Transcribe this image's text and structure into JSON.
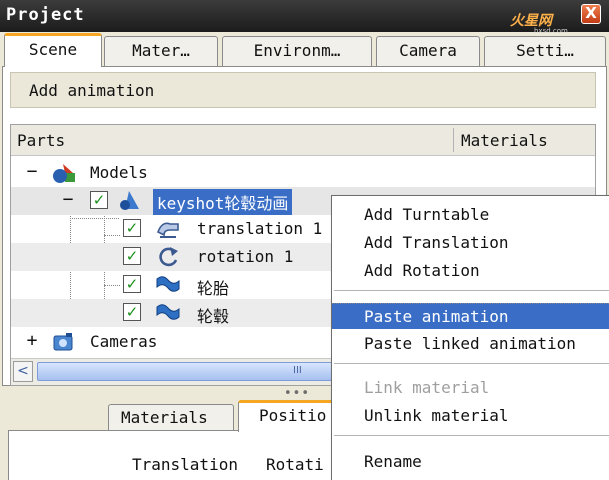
{
  "window": {
    "title": "Project",
    "close_glyph": "X"
  },
  "watermark": {
    "logo": "火星网",
    "url": "hxsd.com"
  },
  "tabs": [
    {
      "label": "Scene",
      "active": true
    },
    {
      "label": "Mater…"
    },
    {
      "label": "Environm…"
    },
    {
      "label": "Camera"
    },
    {
      "label": "Setti…"
    }
  ],
  "toolbar": {
    "add_animation": "Add animation"
  },
  "tree": {
    "columns": {
      "parts": "Parts",
      "materials": "Materials"
    },
    "rows": [
      {
        "expander": "−",
        "label": "Models",
        "icon": "models-icon"
      },
      {
        "expander": "−",
        "label": "keyshot轮毂动画",
        "icon": "part-group-icon",
        "checked": true,
        "selected": true
      },
      {
        "label": "translation 1",
        "icon": "translation-icon",
        "checked": true
      },
      {
        "label": "rotation 1",
        "icon": "rotation-icon",
        "checked": true
      },
      {
        "label": "轮胎",
        "icon": "mesh-icon",
        "checked": true
      },
      {
        "label": "轮毂",
        "icon": "mesh-icon",
        "checked": true
      },
      {
        "expander": "+",
        "label": "Cameras",
        "icon": "camera-icon"
      }
    ],
    "scroll": {
      "left_arrow": "<",
      "grip": "III"
    }
  },
  "splitter": {
    "dots": "•••"
  },
  "bottom_panel": {
    "tabs": [
      {
        "label": "Materials"
      },
      {
        "label": "Positio",
        "active": true
      }
    ],
    "fields": {
      "translation": "Translation",
      "rotation": "Rotati"
    }
  },
  "context_menu": {
    "items": [
      {
        "label": "Add Turntable"
      },
      {
        "label": "Add Translation"
      },
      {
        "label": "Add Rotation"
      },
      {
        "separator": true
      },
      {
        "label": "Paste animation",
        "highlighted": true
      },
      {
        "label": "Paste linked animation"
      },
      {
        "separator": true
      },
      {
        "label": "Link material",
        "disabled": true
      },
      {
        "label": "Unlink material"
      },
      {
        "separator": true
      },
      {
        "label": "Rename"
      }
    ]
  },
  "colors": {
    "selection": "#3a6ec6",
    "active_tab_accent": "#f5a623",
    "check_mark": "#1d8f1d",
    "titlebar": "#2a2a2a"
  }
}
